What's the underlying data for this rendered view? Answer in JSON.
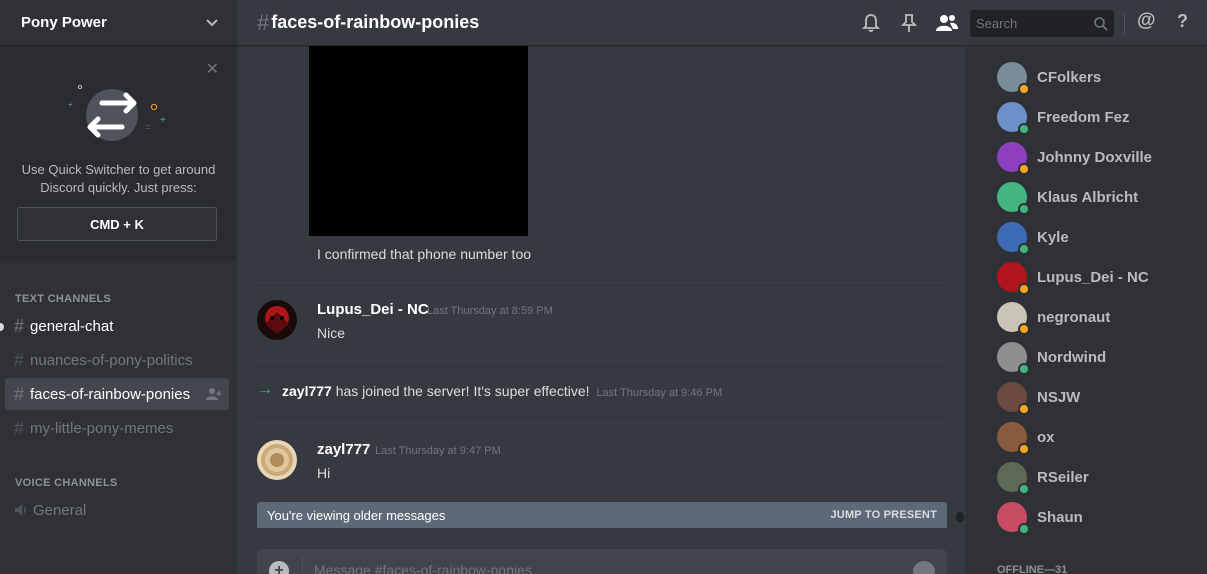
{
  "server": {
    "name": "Pony Power"
  },
  "quick_switcher": {
    "text_line1": "Use Quick Switcher to get around",
    "text_line2": "Discord quickly. Just press:",
    "shortcut": "CMD + K",
    "close_icon": "close-icon"
  },
  "sidebar": {
    "text_category": "TEXT CHANNELS",
    "voice_category": "VOICE CHANNELS",
    "channels": [
      {
        "name": "general-chat",
        "state": "unread"
      },
      {
        "name": "nuances-of-pony-politics",
        "state": "muted"
      },
      {
        "name": "faces-of-rainbow-ponies",
        "state": "selected"
      },
      {
        "name": "my-little-pony-memes",
        "state": "muted"
      }
    ],
    "voice_channels": [
      {
        "name": "General"
      }
    ]
  },
  "header": {
    "hash": "#",
    "channel": "faces-of-rainbow-ponies",
    "search_placeholder": "Search",
    "icons": [
      "bell-icon",
      "pin-icon",
      "members-icon",
      "search-icon",
      "mention-icon",
      "help-icon"
    ],
    "mention": "@",
    "help": "?"
  },
  "messages": [
    {
      "type": "continuation",
      "text": "I confirmed that phone number too"
    },
    {
      "type": "message",
      "author": "Lupus_Dei - NC",
      "timestamp": "Last Thursday at 8:59 PM",
      "text": "Nice"
    },
    {
      "type": "system",
      "author": "zayl777",
      "text": "has joined the server! It's super effective!",
      "timestamp": "Last Thursday at 9:46 PM"
    },
    {
      "type": "message",
      "author": "zayl777",
      "timestamp": "Last Thursday at 9:47 PM",
      "text": "Hi"
    }
  ],
  "older_bar": {
    "text": "You're viewing older messages",
    "jump": "JUMP TO PRESENT"
  },
  "composer": {
    "placeholder": "Message #faces-of-rainbow-ponies"
  },
  "members": [
    {
      "name": "CFolkers",
      "status": "idle",
      "avatar_color": "#7a8b99"
    },
    {
      "name": "Freedom Fez",
      "status": "online",
      "avatar_color": "#6d8fc7"
    },
    {
      "name": "Johnny Doxville",
      "status": "idle",
      "avatar_color": "#8e3fbf"
    },
    {
      "name": "Klaus Albricht",
      "status": "online",
      "avatar_color": "#43b581"
    },
    {
      "name": "Kyle",
      "status": "online",
      "avatar_color": "#3d6bb5"
    },
    {
      "name": "Lupus_Dei - NC",
      "status": "idle",
      "avatar_color": "#b0151b"
    },
    {
      "name": "negronaut",
      "status": "idle",
      "avatar_color": "#c9c4b5"
    },
    {
      "name": "Nordwind",
      "status": "online",
      "avatar_color": "#8f8f8f"
    },
    {
      "name": "NSJW",
      "status": "idle",
      "avatar_color": "#6b4a3f"
    },
    {
      "name": "ox",
      "status": "idle",
      "avatar_color": "#8a5a3c"
    },
    {
      "name": "RSeiler",
      "status": "online",
      "avatar_color": "#5e6a55"
    },
    {
      "name": "Shaun",
      "status": "online",
      "avatar_color": "#c94b63"
    }
  ],
  "offline_header": "OFFLINE—31",
  "colors": {
    "online": "#43b581",
    "idle": "#faa61a",
    "accent": "#7289da",
    "join_arrow": "#43b581"
  }
}
